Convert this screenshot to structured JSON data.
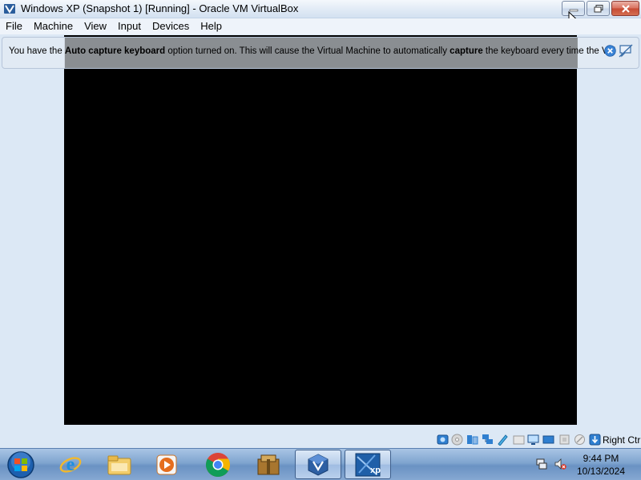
{
  "window": {
    "title": "Windows XP (Snapshot 1) [Running] - Oracle VM VirtualBox",
    "app_icon": "virtualbox-icon",
    "controls": [
      "minimize-icon",
      "maximize-icon",
      "close-icon"
    ]
  },
  "menu": {
    "items": [
      {
        "label": "File"
      },
      {
        "label": "Machine"
      },
      {
        "label": "View"
      },
      {
        "label": "Input"
      },
      {
        "label": "Devices"
      },
      {
        "label": "Help"
      }
    ]
  },
  "notice": {
    "part1": "You have the ",
    "bold1": "Auto capture keyboard",
    "part2": " option turned on. This will cause the Virtual Machine to automatically ",
    "bold2": "capture",
    "part3": " the keyboard every time the VM",
    "close_icon": "close-icon",
    "dont_show_icon": "do-not-show-again-icon"
  },
  "vm_screen": {
    "background": "#000000"
  },
  "status_bar": {
    "icons": [
      "hard-disk-icon",
      "optical-drive-icon",
      "audio-icon",
      "network-icon",
      "usb-icon",
      "shared-folders-icon",
      "display-icon",
      "video-capture-icon",
      "cpu-icon",
      "mouse-integration-icon",
      "keyboard-capture-icon"
    ],
    "host_key": "Right Ctrl"
  },
  "taskbar": {
    "start_icon": "windows-start-icon",
    "items": [
      "internet-explorer-icon",
      "file-explorer-icon",
      "media-player-icon",
      "chrome-icon",
      "archive-icon",
      "virtualbox-icon",
      "windows-xp-vm-icon"
    ],
    "active_items": [
      "virtualbox-icon",
      "windows-xp-vm-icon"
    ],
    "vm_label": "xp",
    "tray": [
      "network-icon",
      "volume-muted-icon"
    ],
    "time": "9:44 PM",
    "date": "10/13/2024"
  },
  "colors": {
    "accent": "#3b7bd4",
    "close_red": "#c64a33",
    "taskbar": "#7fa4cf"
  }
}
